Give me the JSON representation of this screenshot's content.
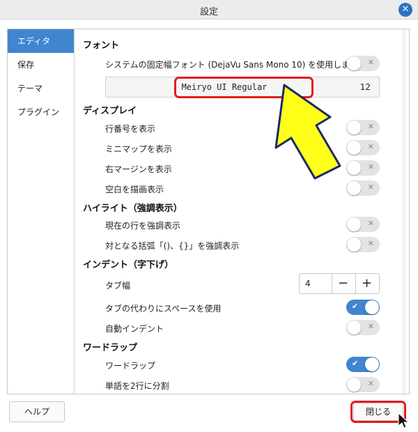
{
  "window": {
    "title": "設定",
    "close_icon": "close-icon"
  },
  "sidebar": {
    "items": [
      {
        "label": "エディタ",
        "active": true
      },
      {
        "label": "保存",
        "active": false
      },
      {
        "label": "テーマ",
        "active": false
      },
      {
        "label": "プラグイン",
        "active": false
      }
    ]
  },
  "font_section": {
    "title": "フォント",
    "system_font_label": "システムの固定幅フォント (DejaVu Sans Mono 10) を使用します",
    "system_font_on": false,
    "font_name": "Meiryo UI Regular",
    "font_size": "12"
  },
  "display_section": {
    "title": "ディスプレイ",
    "items": [
      {
        "label": "行番号を表示",
        "on": false
      },
      {
        "label": "ミニマップを表示",
        "on": false
      },
      {
        "label": "右マージンを表示",
        "on": false
      },
      {
        "label": "空白を描画表示",
        "on": false
      }
    ]
  },
  "highlight_section": {
    "title": "ハイライト（強調表示）",
    "items": [
      {
        "label": "現在の行を強調表示",
        "on": false
      },
      {
        "label": "対となる括弧「()、{}」を強調表示",
        "on": false
      }
    ]
  },
  "indent_section": {
    "title": "インデント（字下げ）",
    "tab_width_label": "タブ幅",
    "tab_width_value": "4",
    "minus_label": "−",
    "plus_label": "+",
    "items": [
      {
        "label": "タブの代わりにスペースを使用",
        "on": true
      },
      {
        "label": "自動インデント",
        "on": false
      }
    ]
  },
  "wrap_section": {
    "title": "ワードラップ",
    "items": [
      {
        "label": "ワードラップ",
        "on": true
      },
      {
        "label": "単語を2行に分割",
        "on": false
      }
    ]
  },
  "toggle_marks": {
    "off": "✕",
    "on": "✔"
  },
  "footer": {
    "help_label": "ヘルプ",
    "close_label": "閉じる"
  },
  "annotation_colors": {
    "highlight_box": "#e31b1b",
    "arrow_fill": "#ffff1a",
    "accent": "#3f86cf"
  }
}
